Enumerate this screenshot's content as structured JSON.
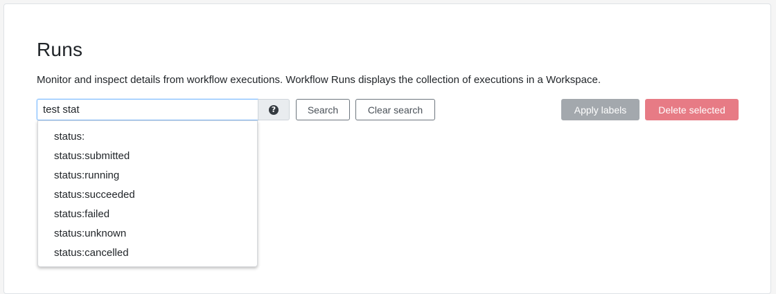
{
  "page": {
    "title": "Runs",
    "description": "Monitor and inspect details from workflow executions. Workflow Runs displays the collection of executions in a Workspace."
  },
  "search": {
    "value": "test stat",
    "help_icon": "question-circle-icon",
    "search_label": "Search",
    "clear_label": "Clear search"
  },
  "actions": {
    "apply_labels": "Apply labels",
    "delete_selected": "Delete selected"
  },
  "suggestions": [
    "status:",
    "status:submitted",
    "status:running",
    "status:succeeded",
    "status:failed",
    "status:unknown",
    "status:cancelled"
  ],
  "colors": {
    "apply_button_bg": "#a3a8ad",
    "delete_button_bg": "#e77b85",
    "input_focus_border": "#80bdff"
  }
}
